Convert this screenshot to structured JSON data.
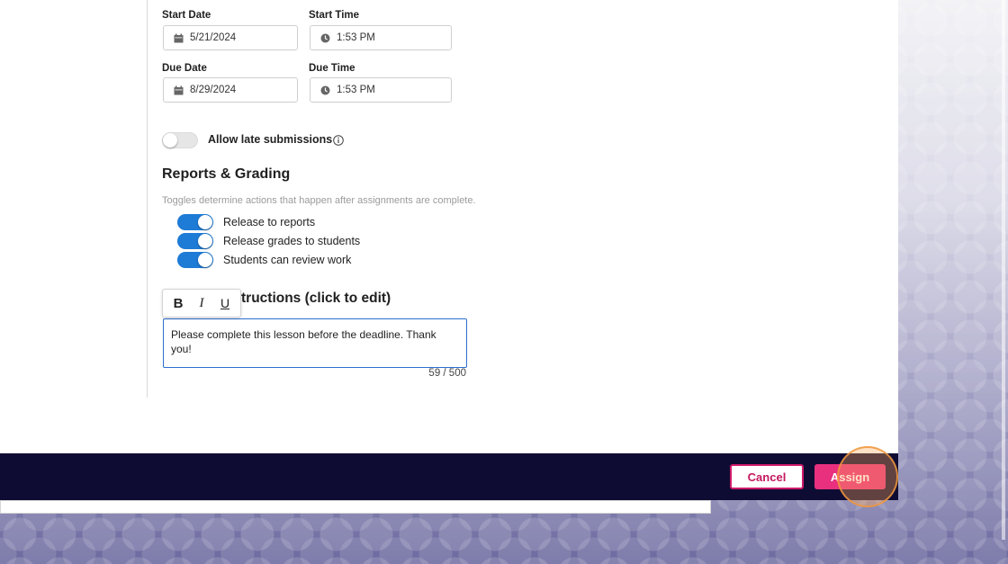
{
  "schedule": {
    "start_date_label": "Start Date",
    "start_date_value": "5/21/2024",
    "start_time_label": "Start Time",
    "start_time_value": "1:53 PM",
    "due_date_label": "Due Date",
    "due_date_value": "8/29/2024",
    "due_time_label": "Due Time",
    "due_time_value": "1:53 PM"
  },
  "late_submissions": {
    "label": "Allow late submissions",
    "enabled": false
  },
  "reports": {
    "title": "Reports & Grading",
    "hint": "Toggles determine actions that happen after assignments are complete.",
    "toggles": [
      {
        "label": "Release to reports",
        "enabled": true
      },
      {
        "label": "Release grades to students",
        "enabled": true
      },
      {
        "label": "Students can review work",
        "enabled": true
      }
    ]
  },
  "instructions": {
    "title_visible": "tructions (click to edit)",
    "bold_label": "B",
    "italic_label": "I",
    "underline_label": "U",
    "text": "Please complete this lesson before the deadline. Thank you!",
    "counter": "59 / 500"
  },
  "footer": {
    "cancel_label": "Cancel",
    "assign_label": "Assign"
  },
  "colors": {
    "accent_blue": "#1e7bd6",
    "brand_pink": "#e8307e",
    "footer_navy": "#0f0c33"
  }
}
